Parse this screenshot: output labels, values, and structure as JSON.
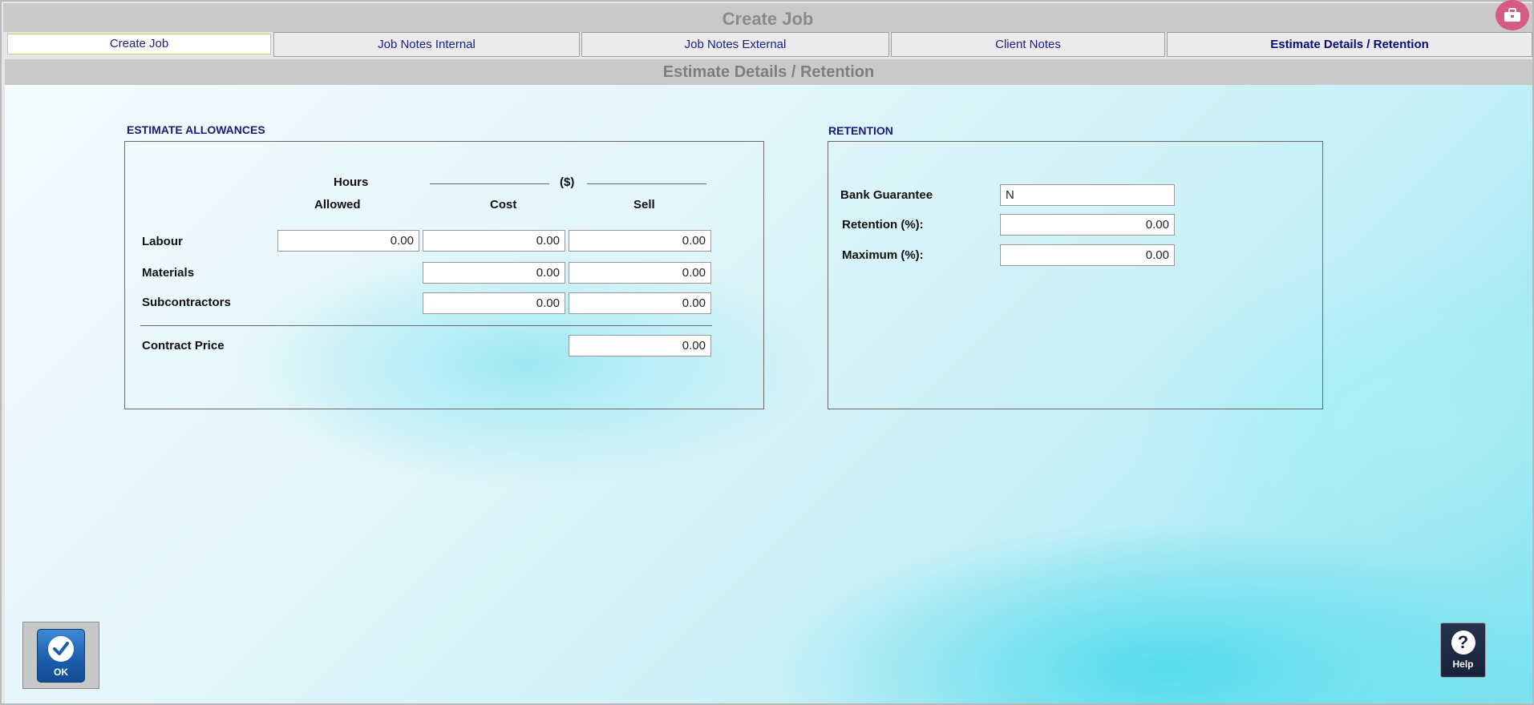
{
  "window": {
    "title": "Create Job"
  },
  "tabs": [
    {
      "label": "Create Job",
      "active": false
    },
    {
      "label": "Job Notes Internal",
      "active": false
    },
    {
      "label": "Job Notes External",
      "active": false
    },
    {
      "label": "Client Notes",
      "active": false
    },
    {
      "label": "Estimate Details / Retention",
      "active": true
    }
  ],
  "section": {
    "title": "Estimate Details / Retention"
  },
  "estimate": {
    "group_label": "ESTIMATE ALLOWANCES",
    "headers": {
      "hours": "Hours",
      "allowed": "Allowed",
      "currency": "($)",
      "cost": "Cost",
      "sell": "Sell"
    },
    "rows": [
      {
        "label": "Labour",
        "hours": "0.00",
        "cost": "0.00",
        "sell": "0.00"
      },
      {
        "label": "Materials",
        "cost": "0.00",
        "sell": "0.00"
      },
      {
        "label": "Subcontractors",
        "cost": "0.00",
        "sell": "0.00"
      }
    ],
    "contract_price": {
      "label": "Contract Price",
      "value": "0.00"
    }
  },
  "retention": {
    "group_label": "RETENTION",
    "bank_guarantee": {
      "label": "Bank Guarantee",
      "value": "N"
    },
    "retention_pct": {
      "label": "Retention (%):",
      "value": "0.00"
    },
    "maximum_pct": {
      "label": "Maximum (%):",
      "value": "0.00"
    }
  },
  "buttons": {
    "ok": "OK",
    "help": "Help"
  },
  "colors": {
    "accent_blue": "#1c5fae",
    "label_navy": "#1a1a7a",
    "title_icon": "#d65b82"
  }
}
